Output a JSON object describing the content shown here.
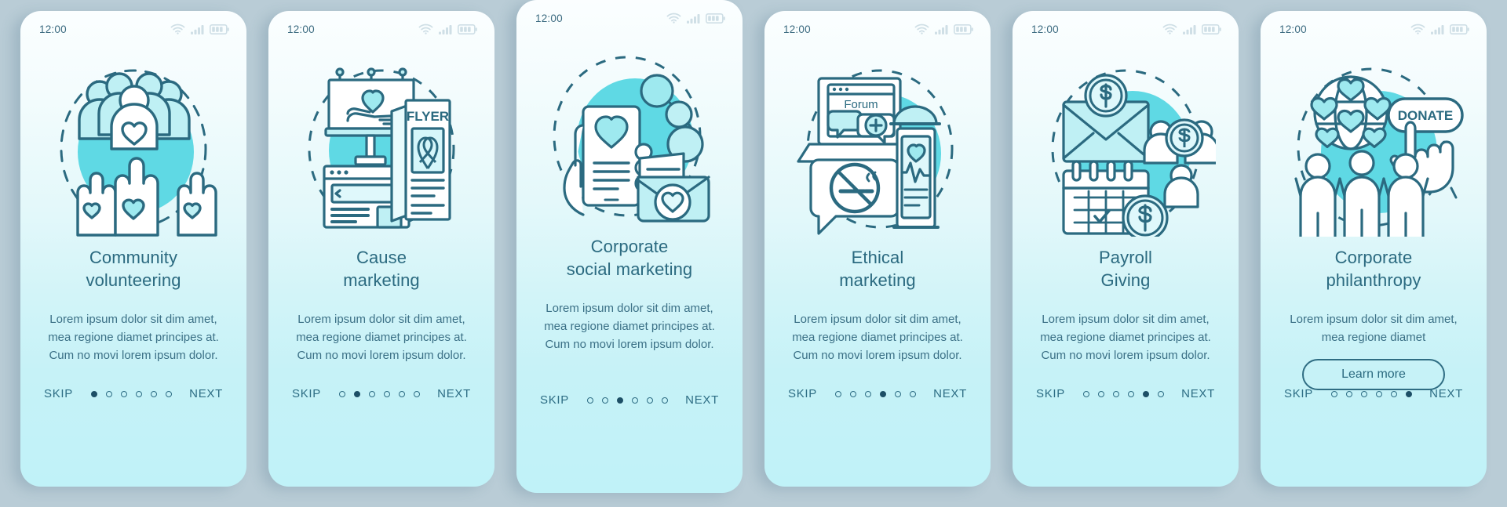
{
  "theme": {
    "page_background": "#b9ccd6",
    "card_gradient_top": "#fbfeff",
    "card_gradient_bottom": "#c0f2f8",
    "accent_stroke": "#2b6a80",
    "accent_fill": "#5fd9e4",
    "title_color": "#2b6a80",
    "body_color": "#3b7086"
  },
  "status_bar": {
    "time": "12:00",
    "icons": [
      "wifi-icon",
      "signal-icon",
      "battery-icon"
    ]
  },
  "nav": {
    "skip_label": "SKIP",
    "next_label": "NEXT",
    "dot_count": 6
  },
  "body_text": "Lorem ipsum dolor sit dim amet, mea regione diamet principes at. Cum no movi lorem ipsum dolor.",
  "body_text_short": "Lorem ipsum dolor sit dim amet, mea regione diamet",
  "cta": {
    "learn_more_label": "Learn more"
  },
  "illustration_labels": {
    "flyer": "FLYER",
    "forum": "Forum",
    "donate": "DONATE"
  },
  "screens": [
    {
      "index": 0,
      "title_line1": "Community",
      "title_line2": "volunteering",
      "illustration": "community-volunteering-illustration",
      "active_dot": 0,
      "raised": false,
      "has_learn_more": false
    },
    {
      "index": 1,
      "title_line1": "Cause",
      "title_line2": "marketing",
      "illustration": "cause-marketing-illustration",
      "active_dot": 1,
      "raised": false,
      "has_learn_more": false
    },
    {
      "index": 2,
      "title_line1": "Corporate",
      "title_line2": "social marketing",
      "illustration": "corporate-social-marketing-illustration",
      "active_dot": 2,
      "raised": true,
      "has_learn_more": false
    },
    {
      "index": 3,
      "title_line1": "Ethical",
      "title_line2": "marketing",
      "illustration": "ethical-marketing-illustration",
      "active_dot": 3,
      "raised": false,
      "has_learn_more": false
    },
    {
      "index": 4,
      "title_line1": "Payroll",
      "title_line2": "Giving",
      "illustration": "payroll-giving-illustration",
      "active_dot": 4,
      "raised": false,
      "has_learn_more": false
    },
    {
      "index": 5,
      "title_line1": "Corporate",
      "title_line2": "philanthropy",
      "illustration": "corporate-philanthropy-illustration",
      "active_dot": 5,
      "raised": false,
      "has_learn_more": true
    }
  ]
}
